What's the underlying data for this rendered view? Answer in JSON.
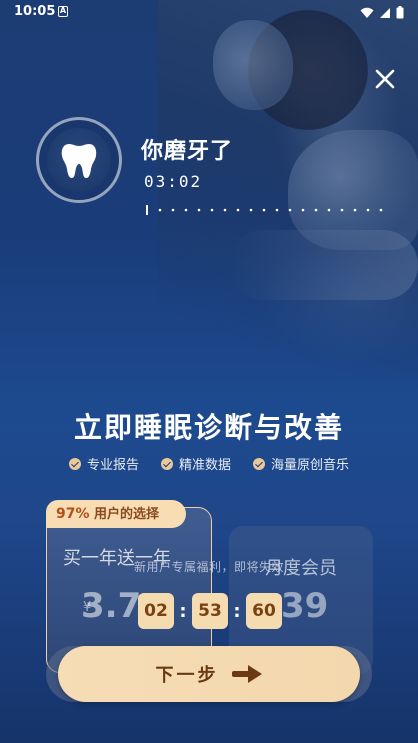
{
  "status_bar": {
    "time": "10:05",
    "notification_icon": "A"
  },
  "recording": {
    "title": "你磨牙了",
    "time": "03:02"
  },
  "headline": "立即睡眠诊断与改善",
  "features": [
    {
      "label": "专业报告"
    },
    {
      "label": "精准数据"
    },
    {
      "label": "海量原创音乐"
    }
  ],
  "plans": {
    "badge_percent": "97%",
    "badge_text": "用户的选择",
    "yearly": {
      "name": "买一年送一年",
      "currency": "¥",
      "price": "3.7"
    },
    "monthly": {
      "name": "月度会员",
      "price": "39"
    }
  },
  "countdown": {
    "text": "新用户专属福利，即将失效",
    "hours": "02",
    "minutes": "53",
    "seconds": "60"
  },
  "cta": {
    "label": "下一步"
  },
  "colors": {
    "accent": "#f5dcb0",
    "background": "#1a3c78",
    "cta_text": "#6b3a12"
  }
}
